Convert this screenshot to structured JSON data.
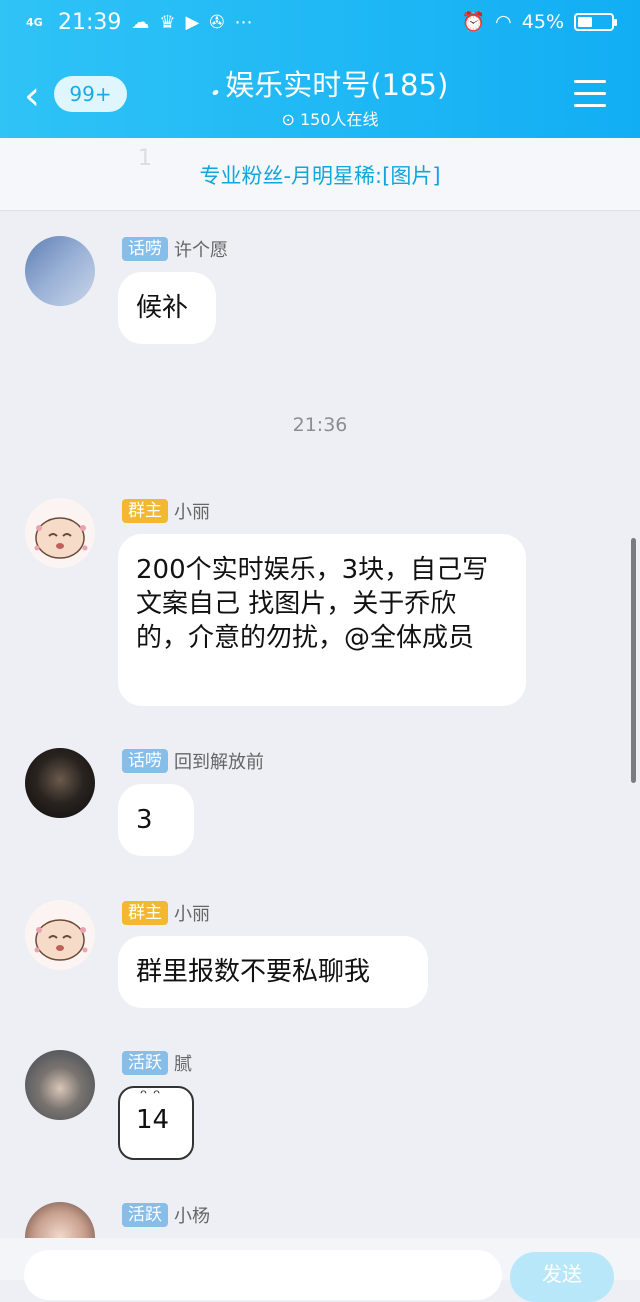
{
  "status_bar": {
    "network": "4G",
    "time": "21:39",
    "battery_percent": "45%",
    "battery_level": 0.45
  },
  "header": {
    "back_count": "99+",
    "title": "娱乐实时号(185)",
    "online": "150人在线"
  },
  "pinned": {
    "text": "专业粉丝-月明星稀:[图片]",
    "faint": "1"
  },
  "messages": [
    {
      "tag": "话唠",
      "sender": "许个愿",
      "text": "候补"
    },
    {
      "tag": "群主",
      "sender": "小丽",
      "text": "200个实时娱乐，3块，自己写文案自己  找图片，关于乔欣的，介意的勿扰，@全体成员"
    },
    {
      "tag": "话唠",
      "sender": "回到解放前",
      "text": "3"
    },
    {
      "tag": "群主",
      "sender": "小丽",
      "text": "群里报数不要私聊我"
    },
    {
      "tag": "活跃",
      "sender": "腻",
      "text": "14"
    },
    {
      "tag": "活跃",
      "sender": "小杨",
      "text": ""
    }
  ],
  "time_separator": "21:36",
  "input": {
    "send_label": "发送"
  },
  "icons": [
    "cloud-icon",
    "crown-icon",
    "play-icon",
    "wechat-icon",
    "more-icon",
    "alarm-icon",
    "wifi-icon",
    "battery-icon",
    "back-icon",
    "ear-icon",
    "online-icon",
    "menu-icon"
  ],
  "colors": {
    "header": "#12aef4",
    "tag_talk": "#87bde9",
    "tag_owner": "#f2b82f",
    "pinned_text": "#11a6dc"
  }
}
